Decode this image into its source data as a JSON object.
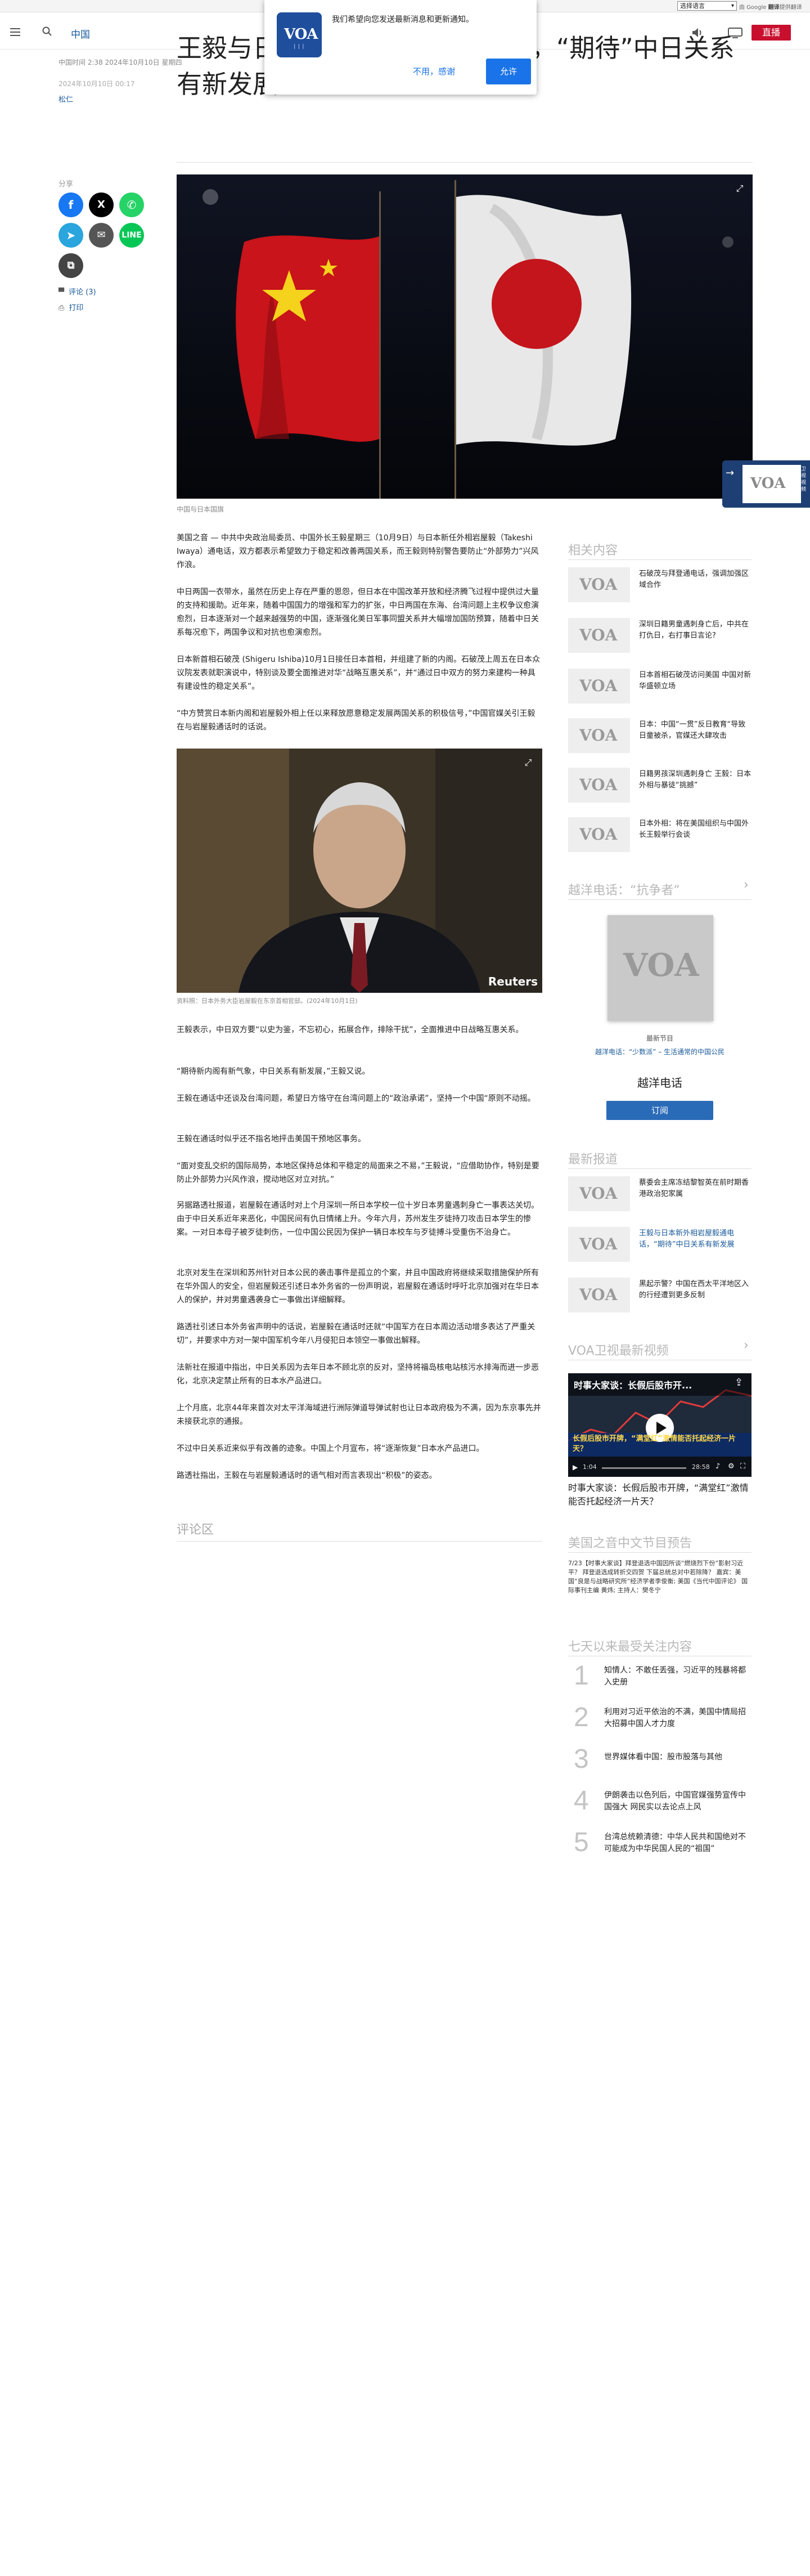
{
  "utility_bar": {
    "language_select": "选择语言",
    "translate_by": "由 Google",
    "translate_word": "翻译",
    "translate_service": "提供翻译"
  },
  "header": {
    "section": "中国",
    "live": "直播"
  },
  "notification": {
    "message": "我们希望向您发送最新消息和更新通知。",
    "decline": "不用，感谢",
    "accept": "允许",
    "logo_text": "VOA"
  },
  "article": {
    "meta_times": "中国时间 2:38 2024年10月10日 星期四",
    "date": "2024年10月10日 00:17",
    "author": "松仁",
    "title": "王毅与日本新外相岩屋毅通电话，“期待”中日关系有新发展",
    "share_label": "分享",
    "comments": "评论 (3)",
    "print": "打印",
    "hero_caption": "中国与日本国旗",
    "image2_caption": "资料照：日本外务大臣岩屋毅在东京首相官邸。(2024年10月1日)",
    "image2_credit": "Reuters",
    "paragraphs_a": [
      "美国之音 — 中共中央政治局委员、中国外长王毅星期三（10月9日）与日本新任外相岩屋毅（Takeshi Iwaya）通电话，双方都表示希望致力于稳定和改善两国关系，而王毅则特别警告要防止“外部势力”兴风作浪。",
      "中日两国一衣带水，虽然在历史上存在严重的恩怨，但日本在中国改革开放和经济腾飞过程中提供过大量的支持和援助。近年来，随着中国国力的增强和军力的扩张，中日两国在东海、台湾问题上主权争议愈演愈烈，日本逐渐对一个越来越强势的中国，逐渐强化美日军事同盟关系并大幅增加国防预算，随着中日关系每况愈下，两国争议和对抗也愈演愈烈。",
      "日本新首相石破茂 (Shigeru Ishiba)10月1日接任日本首相，并组建了新的内阁。石破茂上周五在日本众议院发表就职演说中，特别谈及要全面推进对华“战略互惠关系”，并“通过日中双方的努力来建构一种具有建设性的稳定关系”。",
      "“中方赞赏日本新内阁和岩屋毅外相上任以来释放愿意稳定发展两国关系的积极信号，”中国官媒关引王毅在与岩屋毅通话时的话说。"
    ],
    "paragraphs_b": [
      "王毅表示，中日双方要“以史为鉴，不忘初心，拓展合作，排除干扰”，全面推进中日战略互惠关系。",
      "“期待新内阁有新气象，中日关系有新发展，”王毅又说。",
      "王毅在通话中还谈及台湾问题，希望日方恪守在台湾问题上的“政治承诺”，坚持一个中国“原则不动摇。",
      "王毅在通话时似乎还不指名地抨击美国干预地区事务。",
      "“面对变乱交织的国际局势，本地区保持总体和平稳定的局面来之不易，”王毅说，“应借助协作，特别是要防止外部势力兴风作浪，搅动地区对立对抗。”",
      "另据路透社报道，岩屋毅在通话时对上个月深圳一所日本学校一位十岁日本男童遇刺身亡一事表达关切。由于中日关系近年来恶化，中国民间有仇日情绪上升。今年六月，苏州发生歹徒持刀攻击日本学生的惨案。一对日本母子被歹徒刺伤，一位中国公民因为保护一辆日本校车与歹徒搏斗受重伤不治身亡。",
      "北京对发生在深圳和苏州针对日本公民的袭击事件是孤立的个案，并且中国政府将继续采取措施保护所有在华外国人的安全，但岩屋毅还引述日本外务省的一份声明说，岩屋毅在通话时呼吁北京加强对在华日本人的保护，并对男童遇袭身亡一事做出详细解释。",
      "路透社引述日本外务省声明中的话说，岩屋毅在通话时还就“中国军方在日本周边活动增多表达了严重关切”，并要求中方对一架中国军机今年八月侵犯日本领空一事做出解释。",
      "法新社在报道中指出，中日关系因为去年日本不顾北京的反对，坚持将福岛核电站核污水排海而进一步恶化，北京决定禁止所有的日本水产品进口。",
      "上个月底，北京44年来首次对太平洋海域进行洲际弹道导弹试射也让日本政府极为不满，因为东京事先并未接获北京的通报。",
      "不过中日关系近来似乎有改善的迹象。中国上个月宣布，将“逐渐恢复”日本水产品进口。",
      "路透社指出，王毅在与岩屋毅通话时的语气相对而言表现出“积极”的姿态。"
    ],
    "comments_section": "评论区"
  },
  "sidebar": {
    "related_title": "相关内容",
    "related": [
      "石破茂与拜登通电话，强调加强区域合作",
      "深圳日籍男童遇刺身亡后，中共在打仇日，右打事日言论?",
      "日本首相石破茂访问美国 中国对新华盛顿立场",
      "日本：中国“一贯”反日教育“导致日童被杀，官媒还大肆攻击",
      "日籍男孩深圳遇刺身亡 王毅：日本外相与暴徒“挑撼”",
      "日本外相：将在美国组织与中国外长王毅举行会谈"
    ],
    "podcast_heading": "越洋电话：“抗争者”",
    "podcast_label": "最新节目",
    "podcast_episode": "越洋电话：“少数派” – 生活通常的中国公民",
    "podcast_name": "越洋电话",
    "podcast_subscribe": "订阅",
    "latest_title": "最新报道",
    "latest": [
      "蔡委会主席冻结黎智英在前时期香港政治犯家属",
      "王毅与日本新外相岩屋毅通电话，“期待”中日关系有新发展",
      "黑起示警？中国在西太平洋地区入的行经遭到更多反制"
    ],
    "video_title": "VOA卫视最新视频",
    "video_overlay": "时事大家谈：长假后股市开...",
    "video_banner": "长假后股市开牌，“满堂红”激情能否托起经济一片天？",
    "video_time": "1:04",
    "video_duration": "28:58",
    "video_caption": "时事大家谈：长假后股市开牌，“满堂红”激情能否托起经济一片天？",
    "program_title": "美国之音中文节目预告",
    "program_text": "7/23【时事大家谈】拜登退选中国因所谈“燃烧烈下份”影射习近平？ 拜登退选成转折交四贺 下届总统总对中若除降？ 嘉宾：美国“良是与战略研究所”经济学者李俊衡; 美国《当代中国评论》 国际事刊主编 黄炜; 主持人：樊冬宁",
    "popular_title": "七天以来最受关注内容",
    "popular": [
      "知情人：不敢任丢强，习近平的残暴将都入史册",
      "利用对习近平依治的不满，美国中情局招大招募中国人才力度",
      "世界媒体看中国：股市股落与其他",
      "伊朗袭击以色列后，中国官媒强势宣传中国强大 网民实以去论点上风",
      "台湾总统赖清德：中华人民共和国绝对不可能成为中华民国人民的“祖国”"
    ]
  },
  "side_tab": {
    "logo": "VOA",
    "text": "卫视 视频"
  },
  "colors": {
    "brand_blue": "#1f4e9c",
    "live_red": "#c8102e",
    "link_blue": "#1a5a9a",
    "facebook": "#1877f2",
    "x": "#000000",
    "whatsapp": "#25d366",
    "telegram": "#2aa5dd",
    "email": "#555555",
    "line": "#06c755",
    "copy": "#444444"
  }
}
